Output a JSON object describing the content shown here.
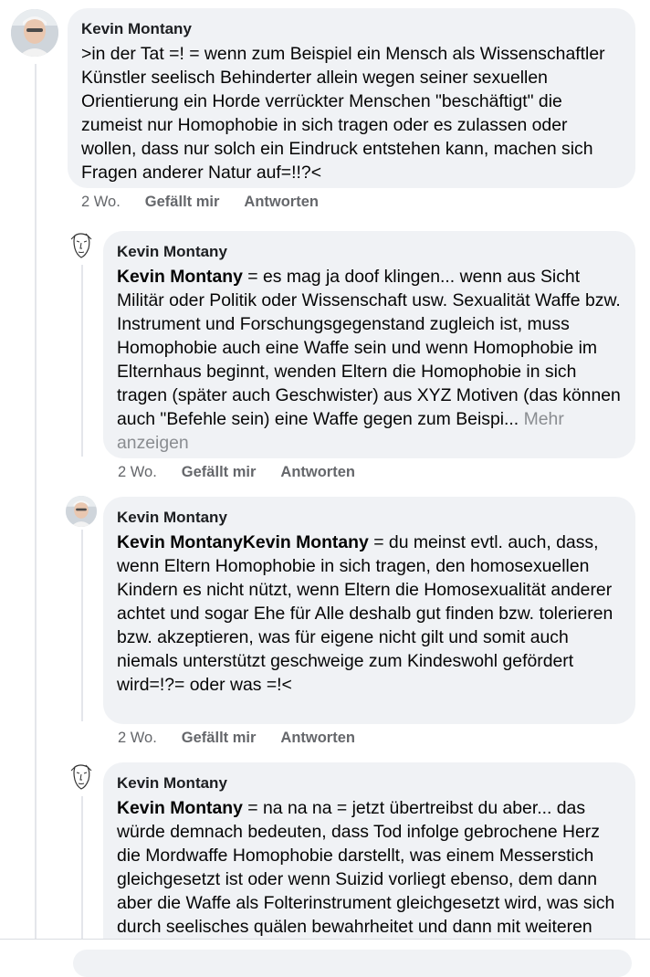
{
  "comments": [
    {
      "author": "Kevin Montany",
      "mention": "",
      "text": ">in der Tat =! = wenn zum Beispiel ein Mensch als Wissenschaftler Künstler seelisch  Behinderter allein wegen seiner sexuellen Orientierung ein Horde verrückter Menschen \"beschäftigt\" die zumeist nur Homophobie in sich tragen oder es zulassen oder wollen, dass nur solch ein Eindruck entstehen kann, machen sich Fragen anderer Natur auf=!!?<",
      "more": "",
      "time": "2 Wo.",
      "like": "Gefällt mir",
      "reply": "Antworten",
      "avatar_icon": "profile-photo-icon"
    },
    {
      "author": "Kevin Montany",
      "mention": "Kevin Montany",
      "text": " = es mag ja doof klingen... wenn aus Sicht Militär oder Politik oder Wissenschaft usw.  Sexualität Waffe bzw. Instrument und Forschungsgegenstand zugleich ist, muss Homophobie auch eine Waffe sein und wenn Homophobie im Elternhaus beginnt, wenden  Eltern die Homophobie in sich tragen (später auch Geschwister) aus XYZ Motiven (das können auch \"Befehle sein) eine Waffe gegen zum Beispi... ",
      "more": "Mehr anzeigen",
      "time": "2 Wo.",
      "like": "Gefällt mir",
      "reply": "Antworten",
      "avatar_icon": "sketch-face-icon"
    },
    {
      "author": "Kevin Montany",
      "mention": "Kevin MontanyKevin Montany",
      "text": " = du meinst evtl. auch, dass, wenn Eltern Homophobie in sich tragen, den homosexuellen Kindern es nicht  nützt, wenn Eltern die Homosexualität anderer achtet und sogar Ehe für Alle deshalb gut finden bzw. tolerieren bzw. akzeptieren, was für eigene nicht gilt und somit auch niemals unterstützt geschweige zum Kindeswohl gefördert wird=!?= oder was =!<",
      "more": "",
      "time": "2 Wo.",
      "like": "Gefällt mir",
      "reply": "Antworten",
      "avatar_icon": "profile-photo-icon"
    },
    {
      "author": "Kevin Montany",
      "mention": "Kevin Montany",
      "text": " = na na na = jetzt übertreibst du aber... das würde demnach bedeuten, dass Tod infolge gebrochene Herz die Mordwaffe Homophobie darstellt, was einem Messerstich gleichgesetzt ist oder wenn Suizid vorliegt ebenso, dem dann aber die Waffe als Folterinstrument gleichgesetzt wird, was sich durch  seelisches quälen bewahrheitet und dann mit weiteren Waffen",
      "more": "",
      "time": "",
      "like": "",
      "reply": "",
      "avatar_icon": "sketch-face-icon"
    }
  ],
  "colors": {
    "bubble": "#f0f2f5",
    "text": "#050505",
    "meta": "#65676b",
    "more": "#8a8d91"
  }
}
